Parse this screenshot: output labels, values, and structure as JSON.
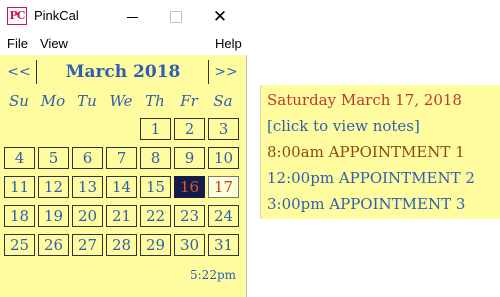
{
  "window": {
    "title": "PinkCal",
    "icon_text": "PC",
    "close_glyph": "✕"
  },
  "menu": {
    "file": "File",
    "view": "View",
    "help": "Help"
  },
  "calendar": {
    "prev_label": "<<",
    "next_label": ">>",
    "month_title": "March 2018",
    "weekdays": [
      "Su",
      "Mo",
      "Tu",
      "We",
      "Th",
      "Fr",
      "Sa"
    ],
    "weeks": [
      [
        "",
        "",
        "",
        "",
        "1",
        "2",
        "3"
      ],
      [
        "4",
        "5",
        "6",
        "7",
        "8",
        "9",
        "10"
      ],
      [
        "11",
        "12",
        "13",
        "14",
        "15",
        "16",
        "17"
      ],
      [
        "18",
        "19",
        "20",
        "21",
        "22",
        "23",
        "24"
      ],
      [
        "25",
        "26",
        "27",
        "28",
        "29",
        "30",
        "31"
      ]
    ],
    "today": "16",
    "selected": "17",
    "time": "5:22pm",
    "colors": {
      "background": "#fffca0",
      "text": "#2e5fb0",
      "today_bg": "#141c4a",
      "selected_text": "#c0392b"
    }
  },
  "notes": {
    "date_heading": "Saturday March 17, 2018",
    "view_notes_link": "[click to view notes]",
    "appointments": [
      "8:00am  APPOINTMENT 1",
      "12:00pm  APPOINTMENT 2",
      "3:00pm  APPOINTMENT 3"
    ]
  }
}
